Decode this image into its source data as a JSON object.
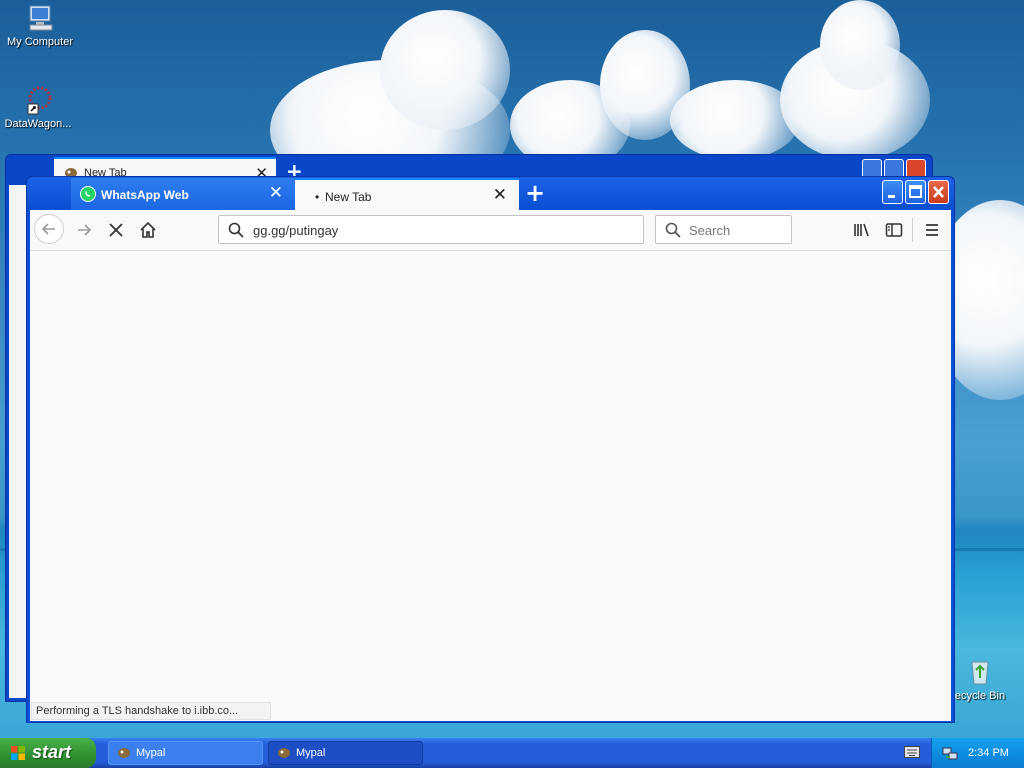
{
  "desktop": {
    "icons": [
      {
        "label": "My Computer"
      },
      {
        "label": "DataWagon..."
      },
      {
        "label": "ecycle Bin"
      }
    ]
  },
  "background_window": {
    "tab_title": "New Tab"
  },
  "browser": {
    "tabs": [
      {
        "label": "WhatsApp Web",
        "active": false
      },
      {
        "label": "New Tab",
        "active": true
      }
    ],
    "url": "gg.gg/putingay",
    "search_placeholder": "Search",
    "status_text": "Performing a TLS handshake to i.ibb.co..."
  },
  "taskbar": {
    "start_label": "start",
    "tasks": [
      {
        "label": "Mypal"
      },
      {
        "label": "Mypal"
      }
    ],
    "clock": "2:34 PM"
  },
  "colors": {
    "titlebar_blue": "#0b4fd6",
    "close_red": "#d9462a",
    "start_green": "#2f8f2f",
    "whatsapp_green": "#25d366"
  }
}
